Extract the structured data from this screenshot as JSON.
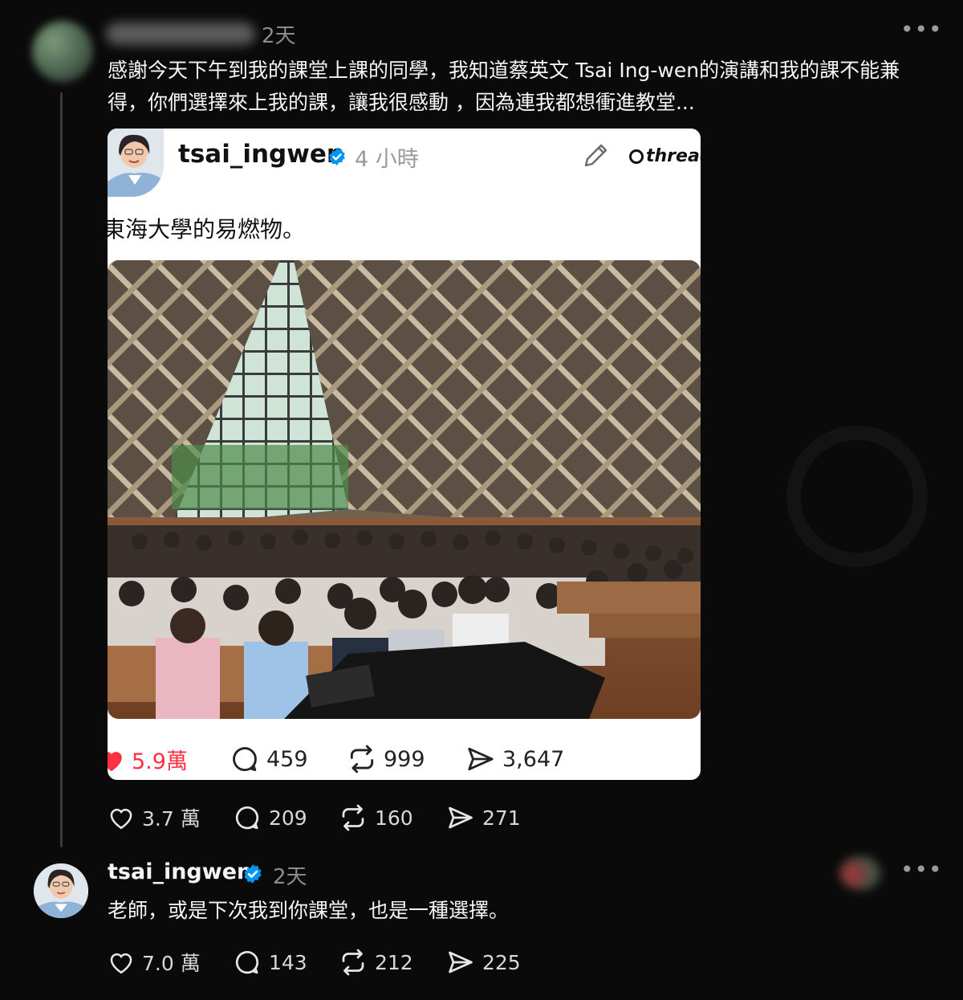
{
  "post": {
    "time": "2天",
    "more": "•••",
    "text": "感謝今天下午到我的課堂上課的同學，我知道蔡英文 Tsai Ing-wen的演講和我的課不能兼得，你們選擇來上我的課，讓我很感動 ，因為連我都想衝進教堂...",
    "stats": {
      "likes": "3.7 萬",
      "replies": "209",
      "reposts": "160",
      "shares": "271"
    }
  },
  "embed": {
    "username": "tsai_ingwen",
    "time": "4 小時",
    "brand": "threads",
    "text": "東海大學的易燃物。",
    "stats": {
      "likes": "5.9萬",
      "replies": "459",
      "reposts": "999",
      "shares": "3,647"
    }
  },
  "reply": {
    "username": "tsai_ingwen",
    "time": "2天",
    "more": "•••",
    "text": "老師，或是下次我到你課堂，也是一種選擇。",
    "stats": {
      "likes": "7.0 萬",
      "replies": "143",
      "reposts": "212",
      "shares": "225"
    }
  },
  "colors": {
    "background": "#0a0a0a",
    "verified": "#0095f6",
    "liked": "#ff3040"
  },
  "icons": [
    "heart-icon",
    "comment-icon",
    "repost-icon",
    "share-icon",
    "verified-badge-icon",
    "pencil-icon",
    "more-icon"
  ]
}
